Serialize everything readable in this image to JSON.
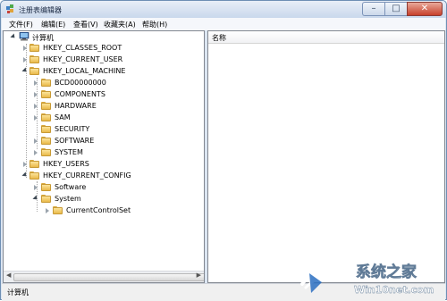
{
  "window": {
    "title": "注册表编辑器"
  },
  "menu": [
    "文件(F)",
    "编辑(E)",
    "查看(V)",
    "收藏夹(A)",
    "帮助(H)"
  ],
  "list": {
    "column_name": "名称"
  },
  "tree": {
    "root": "计算机",
    "hkcr": "HKEY_CLASSES_ROOT",
    "hkcu": "HKEY_CURRENT_USER",
    "hklm": "HKEY_LOCAL_MACHINE",
    "bcd": "BCD00000000",
    "components": "COMPONENTS",
    "hardware": "HARDWARE",
    "sam": "SAM",
    "security": "SECURITY",
    "software": "SOFTWARE",
    "system": "SYSTEM",
    "hku": "HKEY_USERS",
    "hkcc": "HKEY_CURRENT_CONFIG",
    "hkcc_software": "Software",
    "hkcc_system": "System",
    "current_control_set": "CurrentControlSet"
  },
  "status": {
    "path": "计算机"
  },
  "watermark": {
    "brand": "系统之家",
    "site": "Win10net.com"
  }
}
